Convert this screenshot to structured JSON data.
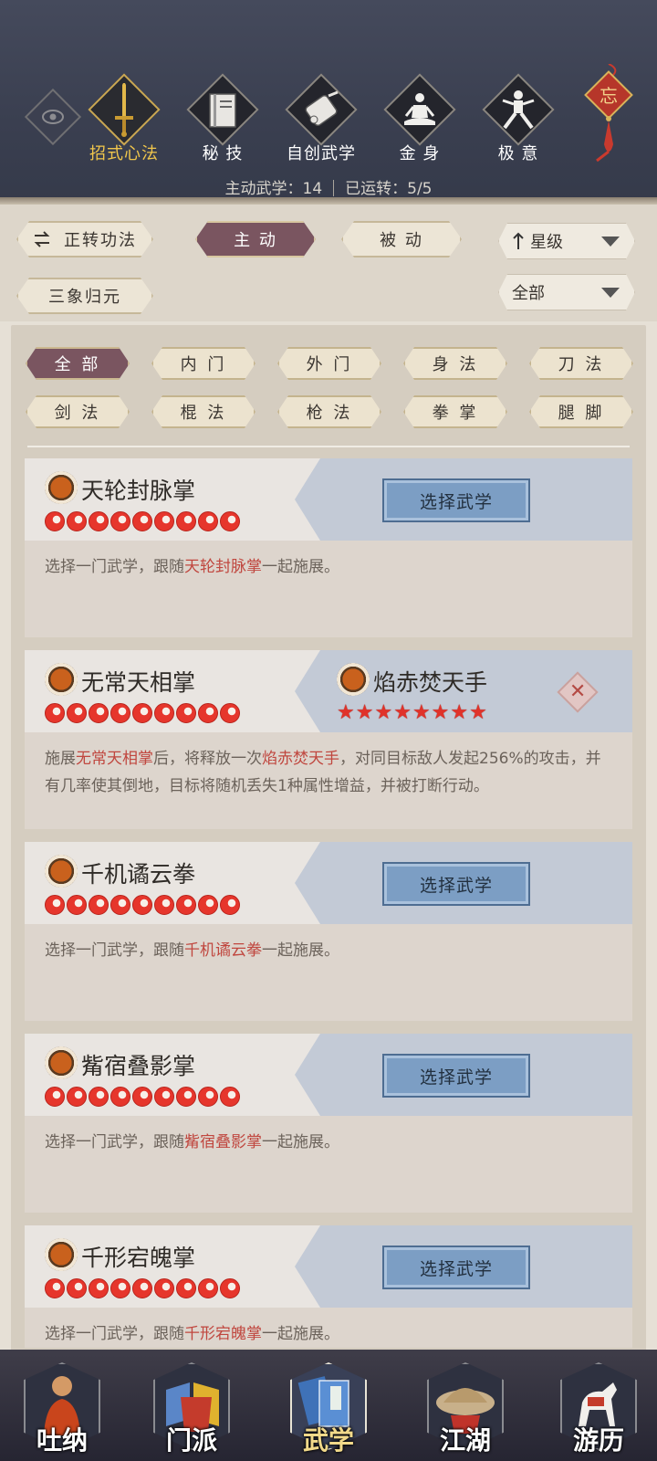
{
  "header": {
    "tabs": [
      {
        "label": "招式心法",
        "icon": "sword-icon",
        "active": true
      },
      {
        "label": "秘 技",
        "icon": "book-icon",
        "active": false
      },
      {
        "label": "自创武学",
        "icon": "scroll-icon",
        "active": false
      },
      {
        "label": "金 身",
        "icon": "meditation-icon",
        "active": false
      },
      {
        "label": "极 意",
        "icon": "stance-icon",
        "active": false
      }
    ],
    "knot_text": "忘",
    "stats": {
      "active_label": "主动武学：14",
      "running_label": "已运转：5/5"
    }
  },
  "filters": {
    "rotate_button": "正转功法",
    "mode_active": "主 动",
    "mode_passive": "被 动",
    "sancai_button": "三象归元",
    "sort_dropdown": "星级",
    "scope_dropdown": "全部"
  },
  "categories": [
    "全 部",
    "内 门",
    "外 门",
    "身 法",
    "刀 法",
    "剑 法",
    "棍 法",
    "枪 法",
    "拳 掌",
    "腿 脚"
  ],
  "cards": [
    {
      "name": "天轮封脉掌",
      "beads": 9,
      "button": "选择武学",
      "desc_pre": "选择一门武学，跟随",
      "desc_hl": "天轮封脉掌",
      "desc_post": "一起施展。"
    },
    {
      "name": "无常天相掌",
      "beads": 9,
      "linked_name": "焰赤焚天手",
      "stars": 8,
      "desc_p1": "施展",
      "desc_h1": "无常天相掌",
      "desc_p2": "后，将释放一次",
      "desc_h2": "焰赤焚天手",
      "desc_p3": "，对同目标敌人发起256%的攻击，并有几率使其倒地，目标将随机丢失1种属性增益，并被打断行动。"
    },
    {
      "name": "千机谲云拳",
      "beads": 9,
      "button": "选择武学",
      "desc_pre": "选择一门武学，跟随",
      "desc_hl": "千机谲云拳",
      "desc_post": "一起施展。"
    },
    {
      "name": "觜宿叠影掌",
      "beads": 9,
      "button": "选择武学",
      "desc_pre": "选择一门武学，跟随",
      "desc_hl": "觜宿叠影掌",
      "desc_post": "一起施展。"
    },
    {
      "name": "千形宕魄掌",
      "beads": 9,
      "button": "选择武学",
      "desc_pre": "选择一门武学，跟随",
      "desc_hl": "千形宕魄掌",
      "desc_post": "一起施展。"
    }
  ],
  "bottom_nav": [
    {
      "label": "吐纳",
      "icon": "monk-icon",
      "active": false
    },
    {
      "label": "门派",
      "icon": "sect-flags-icon",
      "active": false
    },
    {
      "label": "武学",
      "icon": "manual-books-icon",
      "active": true
    },
    {
      "label": "江湖",
      "icon": "straw-hat-icon",
      "active": false
    },
    {
      "label": "游历",
      "icon": "white-horse-icon",
      "active": false
    }
  ],
  "colors": {
    "accent_gold": "#f0c64c",
    "active_plum": "#7a5560",
    "highlight_red": "#c0473f",
    "select_blue": "#7c9ec4"
  }
}
